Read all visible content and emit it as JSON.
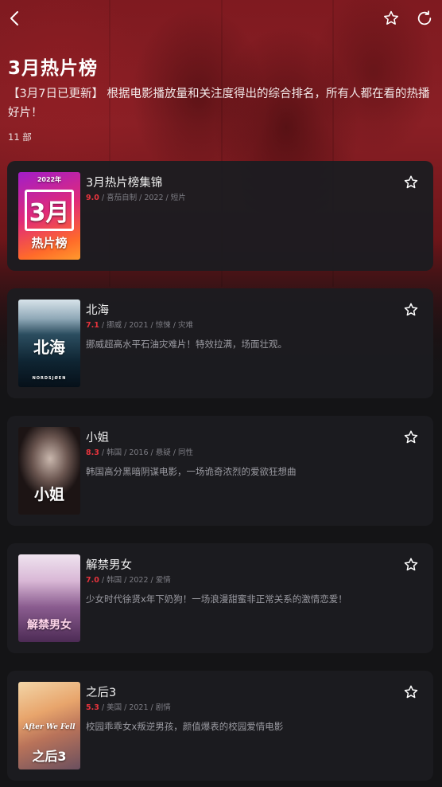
{
  "header": {
    "title": "3月热片榜",
    "description": "【3月7日已更新】 根据电影播放量和关注度得出的综合排名，所有人都在看的热播好片！",
    "count": "11 部"
  },
  "icons": {
    "back": "chevron-left-icon",
    "favorite": "star-outline-icon",
    "share": "refresh-share-icon",
    "item_favorite": "star-outline-icon"
  },
  "colors": {
    "score": "#e8343d",
    "card_bg": "#1c1c20",
    "header_red": "#8a1f25"
  },
  "movies": [
    {
      "title": "3月热片榜集锦",
      "score": "9.0",
      "meta": " / 喜茄自制 / 2022 / 短片",
      "description": "",
      "poster_text": "3月",
      "poster_sub": "热片榜",
      "poster_tag": "2022年"
    },
    {
      "title": "北海",
      "score": "7.1",
      "meta": " / 挪威 / 2021 / 惊悚 / 灾难",
      "description": "挪威超高水平石油灾难片！特效拉满，场面壮观。",
      "poster_text": "北海",
      "poster_sub": "NORDSJØEN"
    },
    {
      "title": "小姐",
      "score": "8.3",
      "meta": " / 韩国 / 2016 / 悬疑 / 同性",
      "description": "韩国高分黑暗阴谋电影，一场诡奇浓烈的爱欲狂想曲",
      "poster_text": "小姐"
    },
    {
      "title": "解禁男女",
      "score": "7.0",
      "meta": " / 韩国 / 2022 / 爱情",
      "description": "少女时代徐贤x年下奶狗！一场浪漫甜蜜非正常关系的激情恋爱！",
      "poster_text": "解禁男女"
    },
    {
      "title": "之后3",
      "score": "5.3",
      "meta": " / 美国 / 2021 / 剧情",
      "description": "校园乖乖女x叛逆男孩，颜值爆表的校园爱情电影",
      "poster_text": "之后3",
      "poster_sub": "After We Fell"
    }
  ]
}
